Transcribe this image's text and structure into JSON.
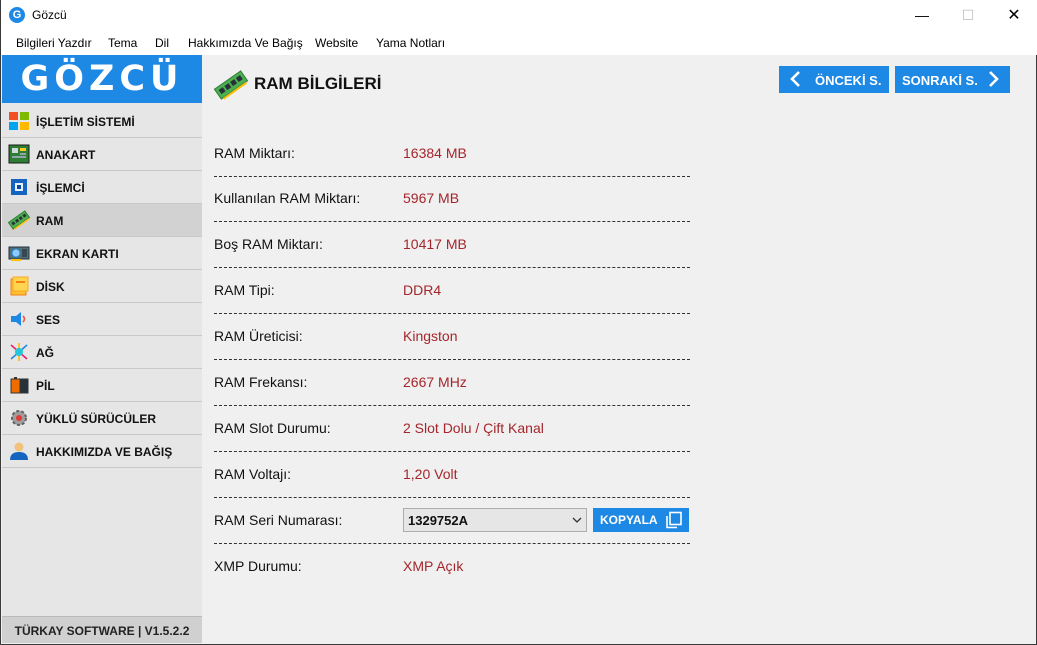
{
  "window": {
    "title": "Gözcü",
    "app_icon_letter": "G",
    "controls": {
      "minimize": "—",
      "maximize": "☐",
      "close": "✕"
    }
  },
  "menu": [
    "Bilgileri Yazdır",
    "Tema",
    "Dil",
    "Hakkımızda Ve Bağış",
    "Website",
    "Yama Notları"
  ],
  "sidebar": {
    "logo": "GÖZCÜ",
    "items": [
      {
        "label": "İŞLETİM SİSTEMİ",
        "icon": "windows-icon"
      },
      {
        "label": "ANAKART",
        "icon": "motherboard-icon"
      },
      {
        "label": "İŞLEMCİ",
        "icon": "cpu-icon"
      },
      {
        "label": "RAM",
        "icon": "ram-icon",
        "active": true
      },
      {
        "label": "EKRAN KARTI",
        "icon": "gpu-icon"
      },
      {
        "label": "DİSK",
        "icon": "disk-icon"
      },
      {
        "label": "SES",
        "icon": "speaker-icon"
      },
      {
        "label": "AĞ",
        "icon": "network-icon"
      },
      {
        "label": "PİL",
        "icon": "battery-icon"
      },
      {
        "label": "YÜKLÜ SÜRÜCÜLER",
        "icon": "drivers-icon"
      },
      {
        "label": "HAKKIMIZDA VE BAĞIŞ",
        "icon": "user-icon"
      }
    ],
    "footer": "TÜRKAY SOFTWARE  |  V1.5.2.2"
  },
  "page": {
    "title": "RAM BİLGİLERİ",
    "prev_label": "ÖNCEKİ S.",
    "next_label": "SONRAKİ S.",
    "rows": [
      {
        "key": "RAM Miktarı:",
        "value": "16384 MB"
      },
      {
        "key": "Kullanılan RAM Miktarı:",
        "value": "5967 MB"
      },
      {
        "key": "Boş RAM Miktarı:",
        "value": "10417 MB"
      },
      {
        "key": "RAM Tipi:",
        "value": "DDR4"
      },
      {
        "key": "RAM Üreticisi:",
        "value": "Kingston"
      },
      {
        "key": "RAM Frekansı:",
        "value": "2667 MHz"
      },
      {
        "key": "RAM Slot Durumu:",
        "value": "2 Slot Dolu / Çift Kanal"
      },
      {
        "key": "RAM Voltajı:",
        "value": "1,20 Volt"
      }
    ],
    "serial": {
      "key": "RAM Seri Numarası:",
      "value": "1329752A",
      "copy_label": "KOPYALA"
    },
    "xmp": {
      "key": "XMP Durumu:",
      "value": "XMP Açık"
    }
  },
  "colors": {
    "accent": "#1e88e5",
    "value_red": "#a4262c",
    "sidebar_bg": "#e6e6e6",
    "sidebar_active": "#d2d2d2"
  }
}
